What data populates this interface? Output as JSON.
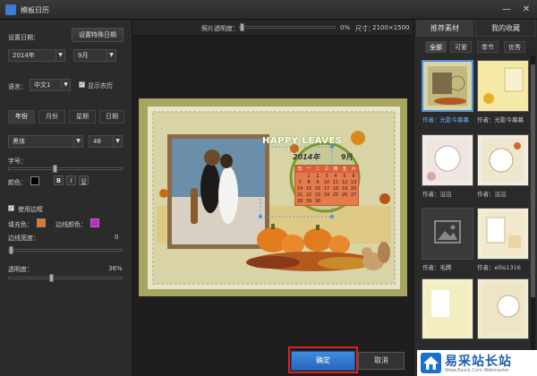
{
  "window": {
    "title": "模板日历",
    "minimize": "—",
    "close": "✕"
  },
  "left": {
    "set_date_label": "设置日期：",
    "special_date_button": "设置特殊日期",
    "year_value": "2014年",
    "month_value": "9月",
    "language_label": "语言：",
    "language_value": "中文1",
    "show_lunar_label": "显示农历",
    "tabs": [
      "年份",
      "月份",
      "星期",
      "日期"
    ],
    "font_value": "黑体",
    "font_size_value": "48",
    "spacing_label": "字号：",
    "color_label": "颜色：",
    "bold": "B",
    "italic": "I",
    "underline": "U",
    "use_border_label": "使用边框",
    "fill_color_label": "填充色：",
    "border_color_label": "边线颜色：",
    "border_width_label": "边线宽度：",
    "border_width_value": "0",
    "opacity_label": "透明度：",
    "opacity_value": "36%",
    "colors": {
      "text": "#000000",
      "fill": "#e8732a",
      "border": "#d21fd6"
    }
  },
  "center": {
    "photo_opacity_label": "照片透明度：",
    "photo_opacity_value": "0%",
    "size_label": "尺寸：",
    "size_value": "2100×1500",
    "calendar": {
      "deco_text": "HAPPY LEAVES",
      "year": "2014年",
      "month": "9月",
      "weekdays": [
        "日",
        "一",
        "二",
        "三",
        "四",
        "五",
        "六"
      ],
      "rows": [
        [
          "",
          "1",
          "2",
          "3",
          "4",
          "5",
          "6"
        ],
        [
          "7",
          "8",
          "9",
          "10",
          "11",
          "12",
          "13"
        ],
        [
          "14",
          "15",
          "16",
          "17",
          "18",
          "19",
          "20"
        ],
        [
          "21",
          "22",
          "23",
          "24",
          "25",
          "26",
          "27"
        ],
        [
          "28",
          "29",
          "30",
          "",
          "",
          "",
          ""
        ]
      ]
    }
  },
  "right": {
    "tabs": [
      "推荐素材",
      "我的收藏"
    ],
    "categories": [
      "全部",
      "可爱",
      "季节",
      "优秀"
    ],
    "thumbs": [
      {
        "author": "作者：光影今幕幕"
      },
      {
        "author": "作者：光影今幕幕"
      },
      {
        "author": "作者：沿沿"
      },
      {
        "author": "作者：沿沿"
      },
      {
        "author": "作者：毛腾"
      },
      {
        "author": "作者：ellis1316"
      }
    ]
  },
  "footer": {
    "ok": "确定",
    "cancel": "取消"
  },
  "watermark": {
    "title": "易采站长站",
    "subtitle": "Www.Easck.Com Webmaster"
  }
}
